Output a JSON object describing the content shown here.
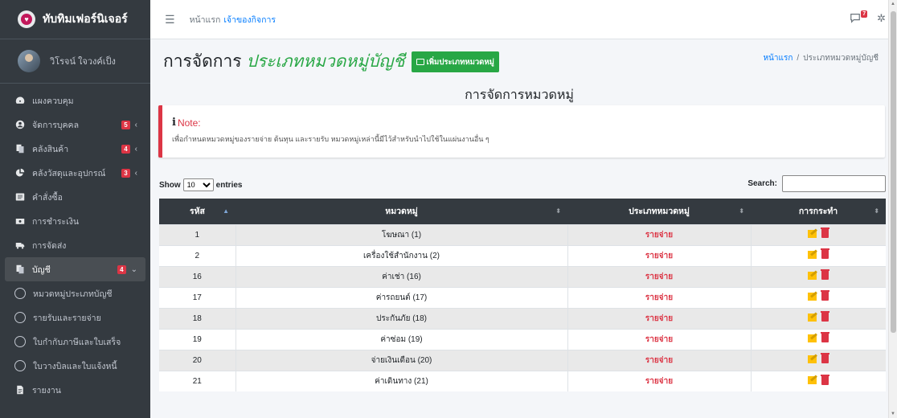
{
  "brand": {
    "name": "ทับทิมเฟอร์นิเจอร์"
  },
  "user": {
    "name": "วิโรจน์ ใจวงค์เป็ง"
  },
  "sidebar": {
    "items": [
      {
        "label": "แผงควบคุม",
        "icon": "dashboard-icon",
        "badge": "",
        "arrow": ""
      },
      {
        "label": "จัดการบุคคล",
        "icon": "user-circle-icon",
        "badge": "5",
        "arrow": "‹"
      },
      {
        "label": "คลังสินค้า",
        "icon": "copy-icon",
        "badge": "4",
        "arrow": "‹"
      },
      {
        "label": "คลังวัสดุและอุปกรณ์",
        "icon": "pie-chart-icon",
        "badge": "3",
        "arrow": "‹"
      },
      {
        "label": "คำสั่งซื้อ",
        "icon": "list-box-icon",
        "badge": "",
        "arrow": ""
      },
      {
        "label": "การชำระเงิน",
        "icon": "money-icon",
        "badge": "",
        "arrow": ""
      },
      {
        "label": "การจัดส่ง",
        "icon": "truck-icon",
        "badge": "",
        "arrow": ""
      },
      {
        "label": "บัญชี",
        "icon": "copy-icon",
        "badge": "4",
        "arrow": "⌄"
      }
    ],
    "subitems": [
      {
        "label": "หมวดหมู่ประเภทบัญชี"
      },
      {
        "label": "รายรับและรายจ่าย"
      },
      {
        "label": "ใบกำกับภาษีและใบเสร็จ"
      },
      {
        "label": "ใบวางบิลและใบแจ้งหนี้"
      }
    ],
    "report": {
      "label": "รายงาน",
      "icon": "file-icon"
    }
  },
  "topbar": {
    "home": "หน้าแรก",
    "owner": "เจ้าของกิจการ",
    "chat_badge": "7"
  },
  "header": {
    "title_static": "การจัดการ",
    "title_italic": "ประเภทหมวดหมู่บัญชี",
    "add_button": "เพิ่มประเภทหมวดหมู่"
  },
  "breadcrumb": {
    "home": "หน้าแรก",
    "sep": "/",
    "current": "ประเภทหมวดหมู่บัญชี"
  },
  "section_title": "การจัดการหมวดหมู่",
  "note": {
    "title": "Note:",
    "icon": "i",
    "text": "เพื่อกำหนดหมวดหมู่ของรายจ่าย ต้นทุน และรายรับ หมวดหมู่เหล่านี้มีไว้สำหรับนำไปใช้ในแผ่นงานอื่น ๆ"
  },
  "datatable": {
    "show_label": "Show",
    "entries_label": "entries",
    "page_length": "10",
    "search_label": "Search:",
    "search_value": "",
    "columns": [
      "รหัส",
      "หมวดหมู่",
      "ประเภทหมวดหมู่",
      "การกระทำ"
    ],
    "rows": [
      {
        "id": "1",
        "category": "โฆษณา (1)",
        "type": "รายจ่าย"
      },
      {
        "id": "2",
        "category": "เครื่องใช้สำนักงาน (2)",
        "type": "รายจ่าย"
      },
      {
        "id": "16",
        "category": "ค่าเช่า (16)",
        "type": "รายจ่าย"
      },
      {
        "id": "17",
        "category": "ค่ารถยนต์ (17)",
        "type": "รายจ่าย"
      },
      {
        "id": "18",
        "category": "ประกันภัย (18)",
        "type": "รายจ่าย"
      },
      {
        "id": "19",
        "category": "ค่าซ่อม (19)",
        "type": "รายจ่าย"
      },
      {
        "id": "20",
        "category": "จ่ายเงินเดือน (20)",
        "type": "รายจ่าย"
      },
      {
        "id": "21",
        "category": "ค่าเดินทาง (21)",
        "type": "รายจ่าย"
      }
    ]
  },
  "colors": {
    "sidebar_bg": "#343a40",
    "accent_green": "#28a745",
    "danger_red": "#dc3545",
    "link_blue": "#007bff"
  }
}
